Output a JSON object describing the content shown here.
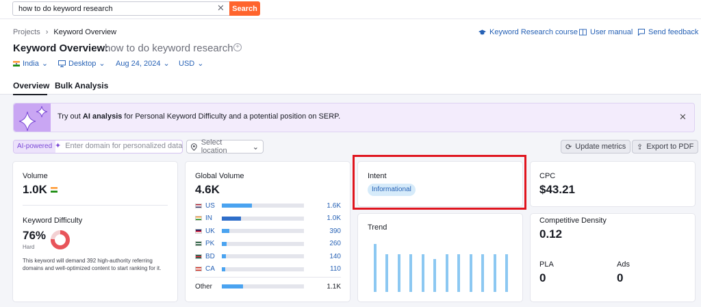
{
  "search": {
    "query": "how to do keyword research",
    "button": "Search",
    "clear_icon": "close-icon"
  },
  "breadcrumb": {
    "root": "Projects",
    "current": "Keyword Overview"
  },
  "header_links": [
    "Keyword Research course",
    "User manual",
    "Send feedback"
  ],
  "page": {
    "title": "Keyword Overview:",
    "keyword": "how to do keyword research"
  },
  "filters": {
    "country": "India",
    "device": "Desktop",
    "date": "Aug 24, 2024",
    "currency": "USD"
  },
  "tabs": [
    "Overview",
    "Bulk Analysis"
  ],
  "banner": {
    "text_pre": "Try out ",
    "text_bold": "AI analysis",
    "text_post": " for Personal Keyword Difficulty and a potential position on SERP."
  },
  "ai": {
    "tag": "AI-powered",
    "placeholder": "Enter domain for personalized data",
    "location": "Select location"
  },
  "actions": {
    "update": "Update metrics",
    "export": "Export to PDF"
  },
  "volume": {
    "label": "Volume",
    "value": "1.0K"
  },
  "difficulty": {
    "label": "Keyword Difficulty",
    "value": "76%",
    "level": "Hard",
    "percent": 76,
    "description": "This keyword will demand 392 high-authority referring domains and well-optimized content to start ranking for it."
  },
  "global_volume": {
    "label": "Global Volume",
    "value": "4.6K",
    "countries": [
      {
        "code": "US",
        "value": "1.6K",
        "share": 0.37
      },
      {
        "code": "IN",
        "value": "1.0K",
        "share": 0.23
      },
      {
        "code": "UK",
        "value": "390",
        "share": 0.09
      },
      {
        "code": "PK",
        "value": "260",
        "share": 0.06
      },
      {
        "code": "BD",
        "value": "140",
        "share": 0.05
      },
      {
        "code": "CA",
        "value": "110",
        "share": 0.04
      }
    ],
    "other": {
      "label": "Other",
      "value": "1.1K",
      "share": 0.26
    }
  },
  "intent": {
    "label": "Intent",
    "value": "Informational"
  },
  "trend": {
    "label": "Trend",
    "values": [
      0.85,
      0.67,
      0.67,
      0.67,
      0.67,
      0.59,
      0.67,
      0.67,
      0.67,
      0.67,
      0.67,
      0.67
    ]
  },
  "cpc": {
    "label": "CPC",
    "value": "$43.21"
  },
  "density": {
    "label": "Competitive Density",
    "value": "0.12"
  },
  "pla": {
    "label": "PLA",
    "value": "0"
  },
  "ads": {
    "label": "Ads",
    "value": "0"
  },
  "colors": {
    "accent": "#ff642d",
    "link": "#2661b5",
    "bar_main": "#4aa3f0",
    "bar_dark": "#2f6ec9",
    "highlight": "#e0141e",
    "difficulty": "#e8545a"
  }
}
